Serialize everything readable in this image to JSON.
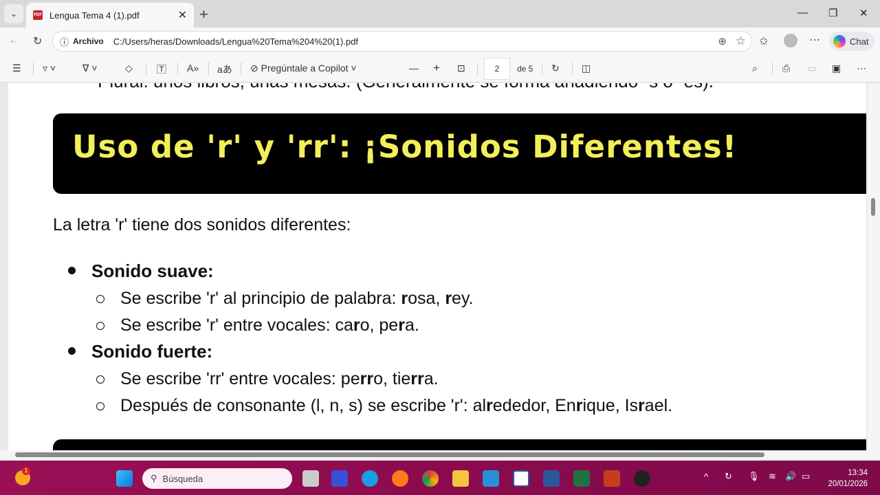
{
  "browser": {
    "tab_title": "Lengua Tema 4 (1).pdf",
    "protocol_label": "Archivo",
    "url": "C:/Users/heras/Downloads/Lengua%20Tema%204%20(1).pdf",
    "chat_label": "Chat"
  },
  "pdf_toolbar": {
    "copilot_label": "Pregúntale a Copilot",
    "page_current": "2",
    "page_total_label": "de 5"
  },
  "document": {
    "clipped_line": "Plural: unos libros, unas mesas. (Generalmente se forma añadiendo -s o -es).",
    "heading": "Uso de 'r' y 'rr': ¡Sonidos Diferentes!",
    "intro": "La letra 'r' tiene dos sonidos diferentes:",
    "sections": [
      {
        "title": "Sonido suave:",
        "items": [
          [
            {
              "t": "Se escribe 'r' al principio de palabra: "
            },
            {
              "t": "r",
              "b": true
            },
            {
              "t": "osa, "
            },
            {
              "t": "r",
              "b": true
            },
            {
              "t": "ey."
            }
          ],
          [
            {
              "t": "Se escribe 'r' entre vocales: ca"
            },
            {
              "t": "r",
              "b": true
            },
            {
              "t": "o, pe"
            },
            {
              "t": "r",
              "b": true
            },
            {
              "t": "a."
            }
          ]
        ]
      },
      {
        "title": "Sonido fuerte:",
        "items": [
          [
            {
              "t": "Se escribe 'rr' entre vocales: pe"
            },
            {
              "t": "rr",
              "b": true
            },
            {
              "t": "o, tie"
            },
            {
              "t": "rr",
              "b": true
            },
            {
              "t": "a."
            }
          ],
          [
            {
              "t": "Después de consonante (l, n, s) se escribe 'r': al"
            },
            {
              "t": "r",
              "b": true
            },
            {
              "t": "ededor, En"
            },
            {
              "t": "r",
              "b": true
            },
            {
              "t": "ique, Is"
            },
            {
              "t": "r",
              "b": true
            },
            {
              "t": "ael."
            }
          ]
        ]
      }
    ]
  },
  "taskbar": {
    "search_placeholder": "Búsqueda",
    "time": "13:34",
    "date": "20/01/2026",
    "weather_badge": "1"
  },
  "colors": {
    "heading_text": "#f3ef5b",
    "heading_bg": "#000000",
    "taskbar": "#8b0b4e"
  }
}
